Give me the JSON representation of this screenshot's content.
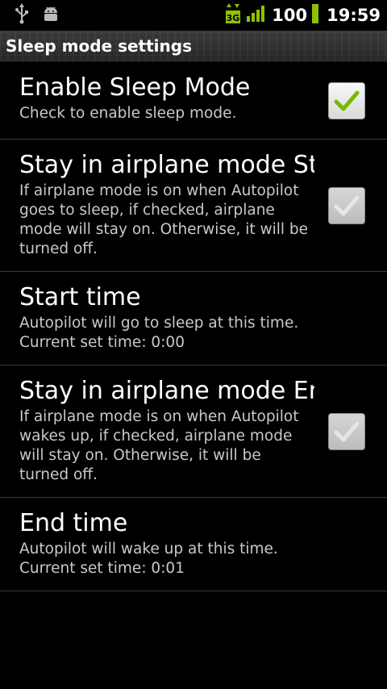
{
  "status_bar": {
    "battery": "100",
    "time": "19:59",
    "network": "3G",
    "icons": [
      "usb-icon",
      "android-debug-icon",
      "3g-icon",
      "signal-icon",
      "battery-icon"
    ]
  },
  "title_bar": {
    "title": "Sleep mode settings"
  },
  "settings": [
    {
      "title": "Enable Sleep Mode",
      "summary": "Check to enable sleep mode.",
      "checked": true
    },
    {
      "title": "Stay in airplane mode Start",
      "summary": "If airplane mode is on when Autopilot goes to sleep, if checked, airplane mode will stay on. Otherwise, it will be turned off.",
      "checked": false
    },
    {
      "title": "Start time",
      "summary": "Autopilot will go to sleep at this time.",
      "summary2": "Current set time: 0:00"
    },
    {
      "title": "Stay in airplane mode End",
      "summary": "If airplane mode is on when Autopilot wakes up, if checked, airplane mode will stay on. Otherwise, it will be turned off.",
      "checked": false
    },
    {
      "title": "End time",
      "summary": "Autopilot will wake up at this time.",
      "summary2": "Current set time: 0:01"
    }
  ],
  "colors": {
    "accent_green": "#8fc100",
    "check_green": "#7ab800",
    "divider": "#3a3a3a"
  }
}
